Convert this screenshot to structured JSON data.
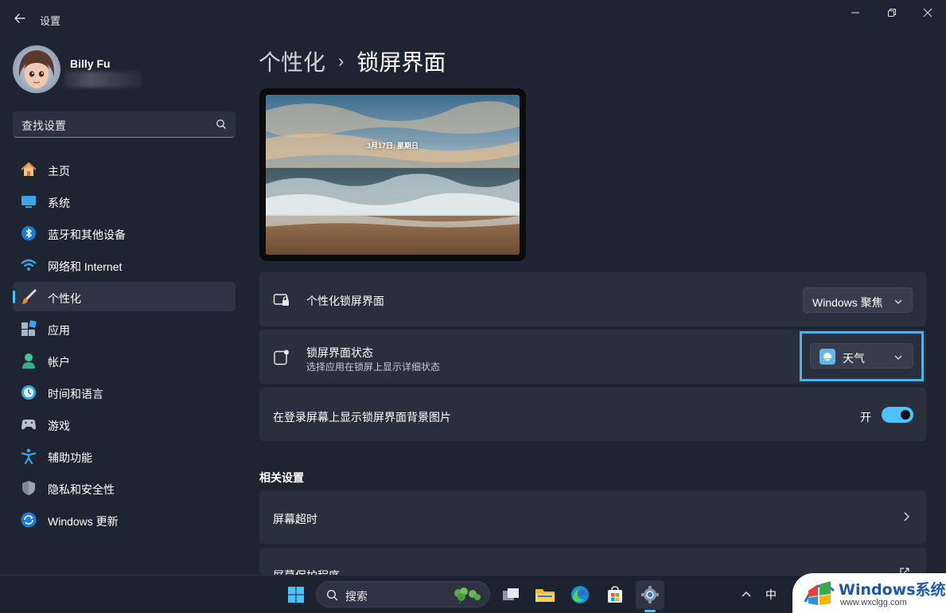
{
  "app": {
    "title": "设置"
  },
  "user": {
    "name": "Billy Fu"
  },
  "search": {
    "placeholder": "查找设置"
  },
  "nav": {
    "items": [
      {
        "label": "主页",
        "icon": "home-icon"
      },
      {
        "label": "系统",
        "icon": "system-icon"
      },
      {
        "label": "蓝牙和其他设备",
        "icon": "bluetooth-icon"
      },
      {
        "label": "网络和 Internet",
        "icon": "wifi-icon"
      },
      {
        "label": "个性化",
        "icon": "brush-icon",
        "active": true
      },
      {
        "label": "应用",
        "icon": "apps-icon"
      },
      {
        "label": "帐户",
        "icon": "account-icon"
      },
      {
        "label": "时间和语言",
        "icon": "time-language-icon"
      },
      {
        "label": "游戏",
        "icon": "gamepad-icon"
      },
      {
        "label": "辅助功能",
        "icon": "accessibility-icon"
      },
      {
        "label": "隐私和安全性",
        "icon": "shield-icon"
      },
      {
        "label": "Windows 更新",
        "icon": "update-icon"
      }
    ]
  },
  "breadcrumb": {
    "parent": "个性化",
    "separator": "›",
    "current": "锁屏界面"
  },
  "preview": {
    "date_text": "3月17日, 星期日"
  },
  "settings": {
    "personalize": {
      "title": "个性化锁屏界面",
      "value": "Windows 聚焦"
    },
    "status": {
      "title": "锁屏界面状态",
      "subtitle": "选择应用在锁屏上显示详细状态",
      "value": "天气"
    },
    "signin_bg": {
      "title": "在登录屏幕上显示锁屏界面背景图片",
      "state": "开"
    }
  },
  "related": {
    "title": "相关设置",
    "items": [
      {
        "label": "屏幕超时"
      },
      {
        "label": "屏幕保护程序"
      }
    ]
  },
  "taskbar": {
    "search_label": "搜索",
    "ime": "中"
  },
  "watermark": {
    "text": "Windows系统城",
    "url": "www.wxclgg.com"
  },
  "colors": {
    "accent": "#4cc2ff",
    "background": "#1f2433",
    "card": "#2a2f3d"
  }
}
